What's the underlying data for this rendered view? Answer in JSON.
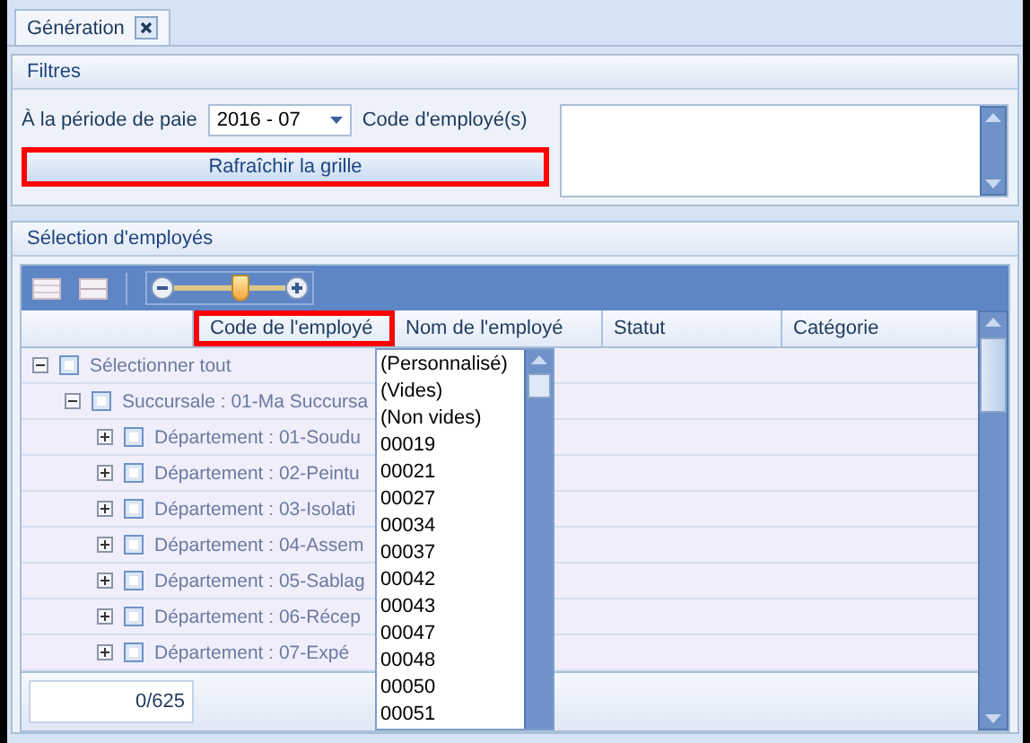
{
  "tabs": [
    {
      "label": "Génération",
      "selected": true,
      "closable": true
    }
  ],
  "filters": {
    "title": "Filtres",
    "period_label": "À la période de paie",
    "period_value": "2016 - 07",
    "code_label": "Code d'employé(s)",
    "refresh_button": {
      "label": "Rafraîchir la grille",
      "highlighted": true
    }
  },
  "selection": {
    "title": "Sélection d'employés",
    "zoom_slider": {
      "level": 0.6
    },
    "columns": [
      {
        "highlighted": false,
        "filter": false
      },
      {
        "label": "Code de l'employé",
        "highlighted": true,
        "filter": true
      },
      {
        "label": "Nom de l'employé",
        "highlighted": false,
        "filter": false
      },
      {
        "label": "Statut",
        "highlighted": false,
        "filter": false
      },
      {
        "label": "Catégorie",
        "highlighted": false,
        "filter": false
      }
    ],
    "tree": [
      {
        "label": "Sélectionner tout",
        "expanded": true,
        "checked": false,
        "children": [
          {
            "label": "Succursale : 01-Ma Succursa",
            "expanded": true,
            "checked": false,
            "children": [
              {
                "label": "Département : 01-Soudu",
                "expanded": false,
                "checked": false
              },
              {
                "label": "Département : 02-Peintu",
                "expanded": false,
                "checked": false
              },
              {
                "label": "Département : 03-Isolati",
                "expanded": false,
                "checked": false
              },
              {
                "label": "Département : 04-Assem",
                "expanded": false,
                "checked": false
              },
              {
                "label": "Département : 05-Sablag",
                "expanded": false,
                "checked": false
              },
              {
                "label": "Département : 06-Récep",
                "expanded": false,
                "checked": false
              },
              {
                "label": "Département : 07-Expé",
                "expanded": false,
                "checked": false
              }
            ]
          }
        ]
      }
    ],
    "count": "0/625",
    "filter_dropdown": [
      "(Personnalisé)",
      "(Vides)",
      "(Non vides)",
      "00019",
      "00021",
      "00027",
      "00034",
      "00037",
      "00042",
      "00043",
      "00047",
      "00048",
      "00050",
      "00051"
    ]
  }
}
